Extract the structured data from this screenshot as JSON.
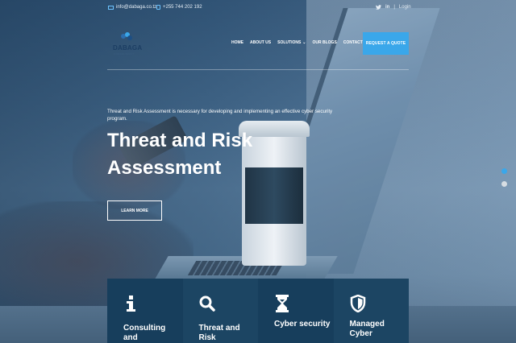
{
  "topbar": {
    "email": "info@dabaga.co.tz",
    "phone": "+255 744 202 192",
    "login": "Login",
    "separator": "|",
    "twitter_icon": "twitter-icon",
    "linkedin_icon": "linkedin-icon"
  },
  "logo": {
    "name": "DABAGA",
    "sub": "CONSULTANCY"
  },
  "nav": {
    "items": [
      "HOME",
      "ABOUT US",
      "SOLUTIONS",
      "OUR BLOGS",
      "CONTACT"
    ],
    "quote_button": "REQUEST A QUOTE"
  },
  "hero": {
    "intro": "Threat and Risk Assessment is necessary for developing and implementing an effective cyber security program.",
    "title": "Threat and Risk Assessment",
    "button": "LEARN MORE"
  },
  "slider": {
    "active_index": 0,
    "count": 2
  },
  "services": [
    {
      "label": "Consulting and",
      "icon": "info-icon"
    },
    {
      "label": "Threat and Risk",
      "icon": "search-icon"
    },
    {
      "label": "Cyber security",
      "icon": "hourglass-icon"
    },
    {
      "label": "Managed Cyber",
      "icon": "shield-icon"
    }
  ],
  "colors": {
    "accent": "#3aa7ea",
    "card_dark": "#173e5c",
    "card_light": "#1c4563",
    "logo": "#1c3e63"
  }
}
